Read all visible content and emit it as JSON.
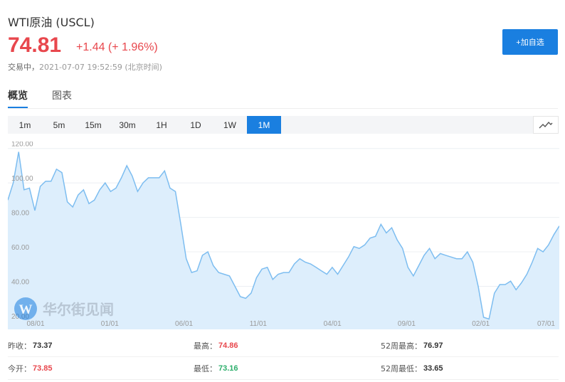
{
  "header": {
    "title": "WTI原油 (USCL)",
    "price": "74.81",
    "change": "+1.44 (+ 1.96%)",
    "status_label": "交易中，",
    "timestamp": "2021-07-07 19:52:59 (北京时间)",
    "add_watch_label": "+加自选"
  },
  "tabs": [
    {
      "label": "概览",
      "active": true
    },
    {
      "label": "图表",
      "active": false
    }
  ],
  "periods": [
    {
      "label": "1m",
      "active": false
    },
    {
      "label": "5m",
      "active": false
    },
    {
      "label": "15m",
      "active": false
    },
    {
      "label": "30m",
      "active": false
    },
    {
      "label": "1H",
      "active": false
    },
    {
      "label": "1D",
      "active": false
    },
    {
      "label": "1W",
      "active": false
    },
    {
      "label": "1M",
      "active": true
    }
  ],
  "chart_type_icon": "line-chart-icon",
  "watermark": "华尔街见闻",
  "colors": {
    "accent": "#1a7fe0",
    "up": "#e8474d",
    "down": "#2cae6b",
    "line": "#7dbdf0",
    "area": "#ddeefc"
  },
  "chart_data": {
    "type": "area",
    "y_ticks": [
      "120.00",
      "100.00",
      "80.00",
      "60.00",
      "40.00",
      "20.00"
    ],
    "ylim": [
      15,
      124
    ],
    "x_ticks": [
      "08/01",
      "01/01",
      "06/01",
      "11/01",
      "04/01",
      "09/01",
      "02/01",
      "07/01"
    ],
    "grid": true,
    "values": [
      90,
      100,
      118,
      96,
      97,
      84,
      98,
      101,
      101,
      108,
      106,
      89,
      86,
      93,
      96,
      88,
      90,
      96,
      100,
      95,
      97,
      103,
      110,
      104,
      95,
      100,
      103,
      103,
      103,
      107,
      97,
      95,
      76,
      56,
      48,
      49,
      58,
      60,
      52,
      48,
      47,
      46,
      40,
      34,
      33,
      36,
      45,
      50,
      51,
      44,
      47,
      48,
      48,
      53,
      56,
      54,
      53,
      51,
      49,
      47,
      51,
      47,
      52,
      57,
      63,
      62,
      64,
      68,
      69,
      76,
      71,
      74,
      67,
      62,
      51,
      46,
      52,
      58,
      62,
      56,
      59,
      58,
      57,
      56,
      56,
      60,
      54,
      40,
      22,
      21,
      36,
      41,
      41,
      43,
      38,
      42,
      47,
      54,
      62,
      60,
      64,
      70,
      75
    ]
  },
  "stats": {
    "prev_close": {
      "label": "昨收：",
      "value": "73.37"
    },
    "high": {
      "label": "最高：",
      "value": "74.86"
    },
    "wk52_high": {
      "label": "52周最高：",
      "value": "76.97"
    },
    "open": {
      "label": "今开：",
      "value": "73.85"
    },
    "low": {
      "label": "最低：",
      "value": "73.16"
    },
    "wk52_low": {
      "label": "52周最低：",
      "value": "33.65"
    }
  }
}
